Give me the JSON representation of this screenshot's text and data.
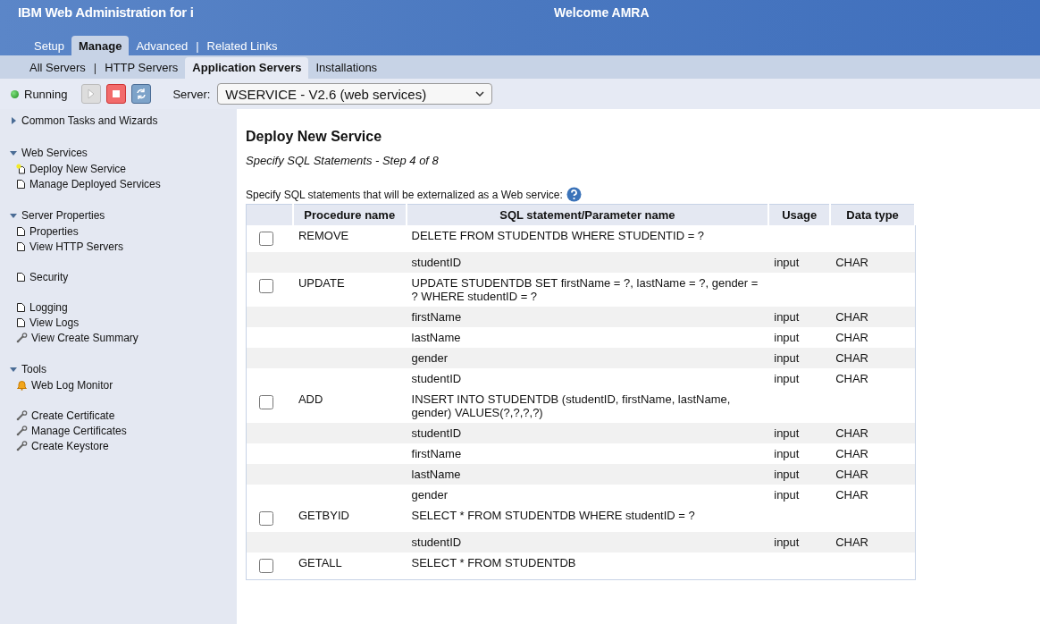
{
  "header": {
    "title": "IBM Web Administration for i",
    "welcome": "Welcome  AMRA"
  },
  "main_tabs": [
    {
      "label": "Setup",
      "selected": false
    },
    {
      "label": "Manage",
      "selected": true
    },
    {
      "label": "Advanced",
      "selected": false
    },
    {
      "label": "Related Links",
      "selected": false,
      "separator": "|"
    }
  ],
  "sub_tabs": [
    {
      "label": "All Servers",
      "selected": false
    },
    {
      "label": "HTTP Servers",
      "selected": false,
      "separator": "|"
    },
    {
      "label": "Application Servers",
      "selected": true
    },
    {
      "label": "Installations",
      "selected": false
    }
  ],
  "toolbar": {
    "status": "Running",
    "server_label": "Server:",
    "server_value": "WSERVICE - V2.6 (web services)"
  },
  "sidebar": [
    {
      "label": "Common Tasks and Wizards",
      "expanded": false
    },
    {
      "label": "Web Services",
      "expanded": true,
      "groups": [
        [
          {
            "label": "Deploy New Service",
            "kind": "wizard"
          },
          {
            "label": "Manage Deployed Services",
            "kind": "page"
          }
        ]
      ]
    },
    {
      "label": "Server Properties",
      "expanded": true,
      "groups": [
        [
          {
            "label": "Properties",
            "kind": "page"
          },
          {
            "label": "View HTTP Servers",
            "kind": "page"
          }
        ],
        [
          {
            "label": "Security",
            "kind": "page"
          }
        ],
        [
          {
            "label": "Logging",
            "kind": "page"
          },
          {
            "label": "View Logs",
            "kind": "page"
          },
          {
            "label": "View Create Summary",
            "kind": "tool"
          }
        ]
      ]
    },
    {
      "label": "Tools",
      "expanded": true,
      "groups": [
        [
          {
            "label": "Web Log Monitor",
            "kind": "monitor"
          }
        ],
        [
          {
            "label": "Create Certificate",
            "kind": "tool"
          },
          {
            "label": "Manage Certificates",
            "kind": "tool"
          },
          {
            "label": "Create Keystore",
            "kind": "tool"
          }
        ]
      ]
    }
  ],
  "content": {
    "title": "Deploy New Service",
    "subtitle": "Specify SQL Statements - Step 4 of 8",
    "instruction": "Specify SQL statements that will be externalized as a Web service:",
    "columns": [
      "Procedure name",
      "SQL statement/Parameter name",
      "Usage",
      "Data type"
    ],
    "procedures": [
      {
        "name": "REMOVE",
        "checked": false,
        "statement": "DELETE FROM STUDENTDB WHERE STUDENTID = ?",
        "params": [
          {
            "name": "studentID",
            "usage": "input",
            "type": "CHAR"
          }
        ]
      },
      {
        "name": "UPDATE",
        "checked": false,
        "statement": "UPDATE STUDENTDB SET firstName = ?, lastName = ?, gender = ? WHERE studentID = ?",
        "params": [
          {
            "name": "firstName",
            "usage": "input",
            "type": "CHAR"
          },
          {
            "name": "lastName",
            "usage": "input",
            "type": "CHAR"
          },
          {
            "name": "gender",
            "usage": "input",
            "type": "CHAR"
          },
          {
            "name": "studentID",
            "usage": "input",
            "type": "CHAR"
          }
        ]
      },
      {
        "name": "ADD",
        "checked": false,
        "statement": "INSERT INTO STUDENTDB (studentID, firstName, lastName, gender) VALUES(?,?,?,?)",
        "params": [
          {
            "name": "studentID",
            "usage": "input",
            "type": "CHAR"
          },
          {
            "name": "firstName",
            "usage": "input",
            "type": "CHAR"
          },
          {
            "name": "lastName",
            "usage": "input",
            "type": "CHAR"
          },
          {
            "name": "gender",
            "usage": "input",
            "type": "CHAR"
          }
        ]
      },
      {
        "name": "GETBYID",
        "checked": false,
        "statement": "SELECT * FROM STUDENTDB WHERE studentID = ?",
        "params": [
          {
            "name": "studentID",
            "usage": "input",
            "type": "CHAR"
          }
        ]
      },
      {
        "name": "GETALL",
        "checked": false,
        "statement": "SELECT * FROM STUDENTDB"
      }
    ]
  }
}
